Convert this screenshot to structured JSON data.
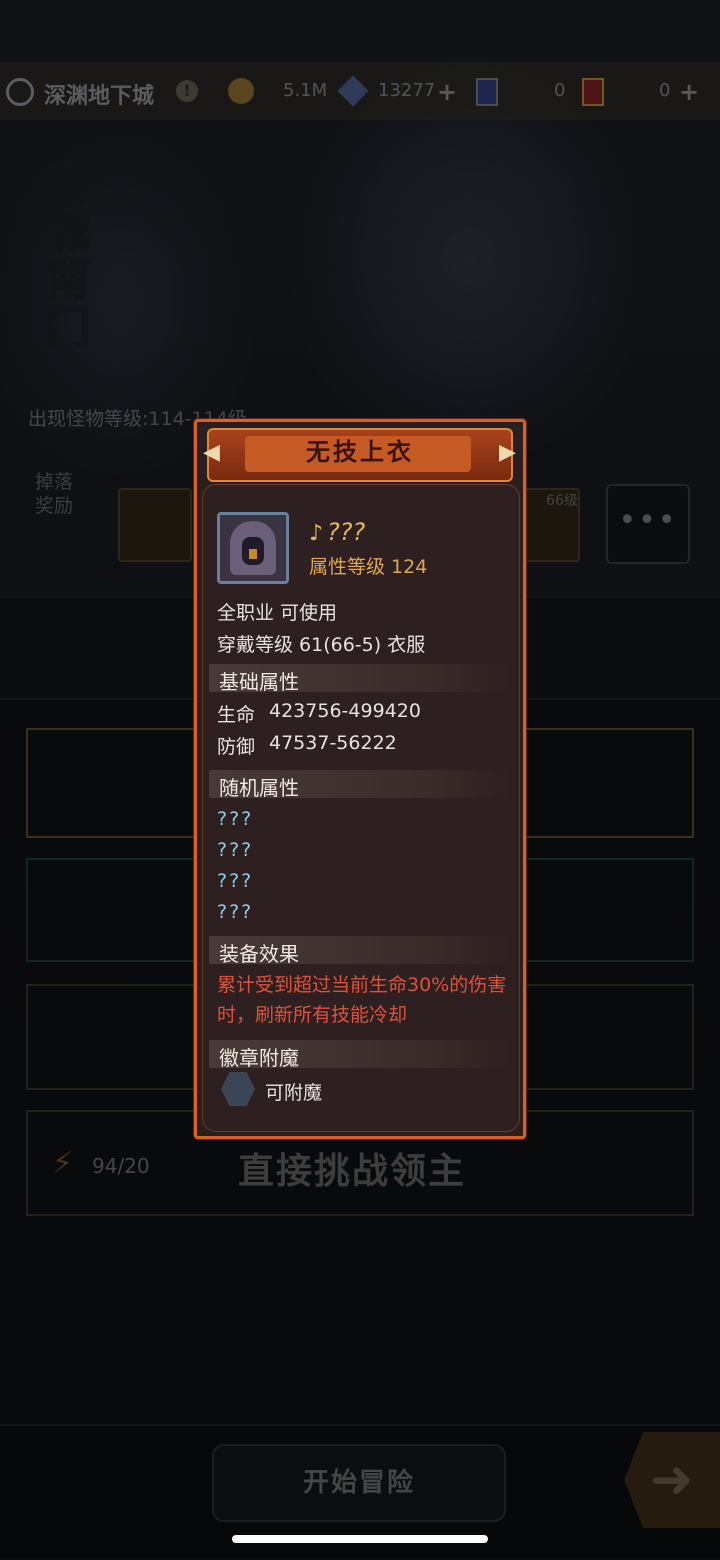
{
  "topbar": {
    "location": "深渊地下城",
    "alert": "!",
    "gold": "5.1M",
    "gems": "13277",
    "blue_ticket": "0",
    "red_ticket": "0",
    "plus": "+"
  },
  "stage": {
    "title": "白城南门",
    "monster_level": "出现怪物等级:114-114级",
    "drop_label": "掉落奖励",
    "drop_item_level": "66级",
    "more": "•••"
  },
  "challenge": {
    "energy": "94/20",
    "label": "直接挑战领主"
  },
  "bottom": {
    "start": "开始冒险"
  },
  "popup": {
    "title": "无技上衣",
    "item_name": "???",
    "attr_level": "属性等级 124",
    "class_req": "全职业 可使用",
    "wear_level": "穿戴等级 61(66-5) 衣服",
    "base_header": "基础属性",
    "hp_label": "生命",
    "hp_value": "423756-499420",
    "def_label": "防御",
    "def_value": "47537-56222",
    "random_header": "随机属性",
    "random": [
      "???",
      "???",
      "???",
      "???"
    ],
    "effect_header": "装备效果",
    "effect_text": "累计受到超过当前生命30%的伤害时，刷新所有技能冷却",
    "badge_header": "徽章附魔",
    "badge_text": "可附魔"
  },
  "colors": {
    "popup_border": "#d8612a",
    "effect_red": "#e0513a",
    "unknown_cyan": "#8fcbe6",
    "gold_text": "#e8b55a"
  }
}
